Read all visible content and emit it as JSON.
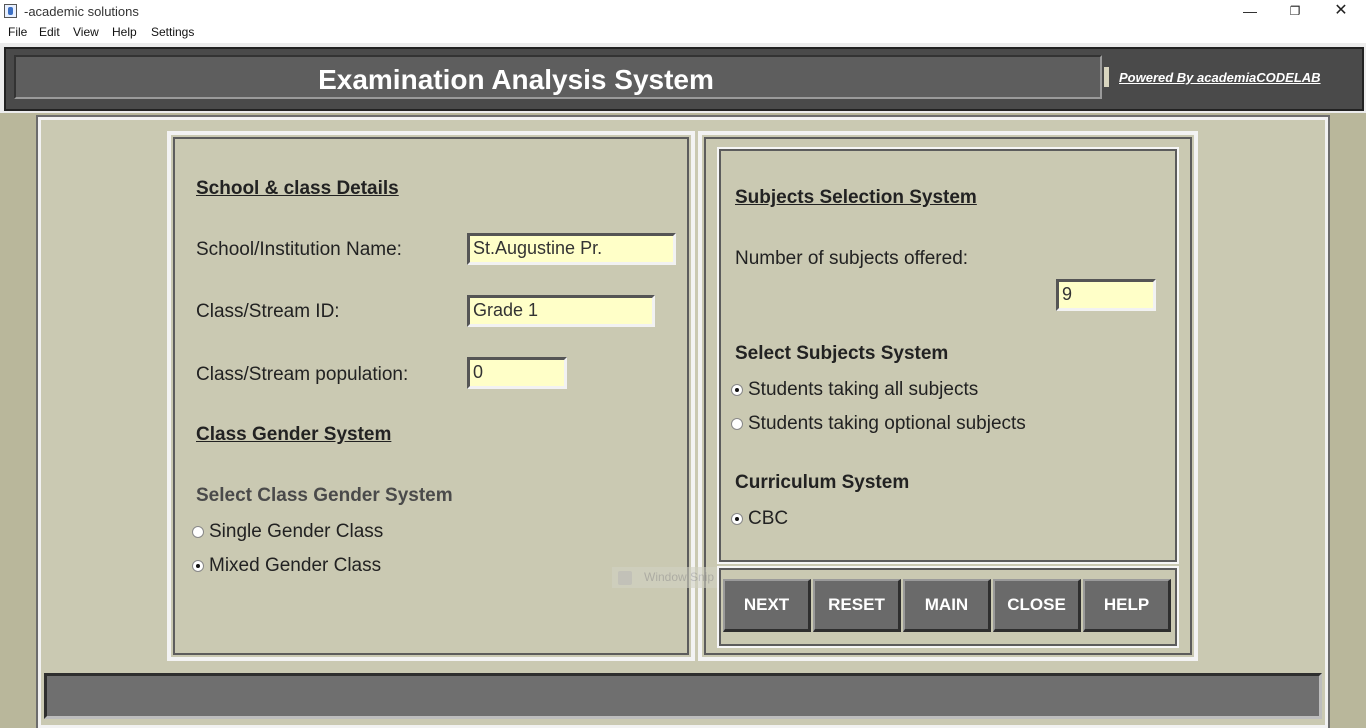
{
  "window": {
    "title": "-academic solutions",
    "controls": {
      "minimize": "—",
      "maximize": "❐",
      "close": "✕"
    }
  },
  "menu": [
    "File",
    "Edit",
    "View",
    "Help",
    "Settings"
  ],
  "header": {
    "title": "Examination Analysis System",
    "powered_by": "Powered By academiaCODELAB"
  },
  "school": {
    "heading": "School & class Details",
    "name_label": "School/Institution Name:",
    "name_value": "St.Augustine Pr.",
    "class_label": "Class/Stream ID:",
    "class_value": "Grade 1",
    "population_label": "Class/Stream population:",
    "population_value": "0"
  },
  "gender": {
    "heading": "Class Gender System",
    "subheading": "Select Class Gender System",
    "options": [
      {
        "label": "Single Gender Class",
        "checked": false
      },
      {
        "label": "Mixed Gender Class",
        "checked": true
      }
    ]
  },
  "subjects": {
    "heading": "Subjects Selection System",
    "count_label": "Number of subjects offered:",
    "count_value": "9",
    "select_heading": "Select Subjects System",
    "options": [
      {
        "label": "Students taking all subjects",
        "checked": true
      },
      {
        "label": "Students taking optional subjects",
        "checked": false
      }
    ]
  },
  "curriculum": {
    "heading": "Curriculum System",
    "options": [
      {
        "label": "CBC",
        "checked": true
      }
    ]
  },
  "buttons": [
    "NEXT",
    "RESET",
    "MAIN",
    "CLOSE",
    "HELP"
  ],
  "overlay": {
    "text": "Window Snip"
  },
  "colors": {
    "panel_bg": "#cac9b2",
    "outer_bg": "#b9b79b",
    "field_bg": "#ffffc8",
    "button_bg": "#6a6a6a",
    "header_bg": "#5e5e5e"
  }
}
